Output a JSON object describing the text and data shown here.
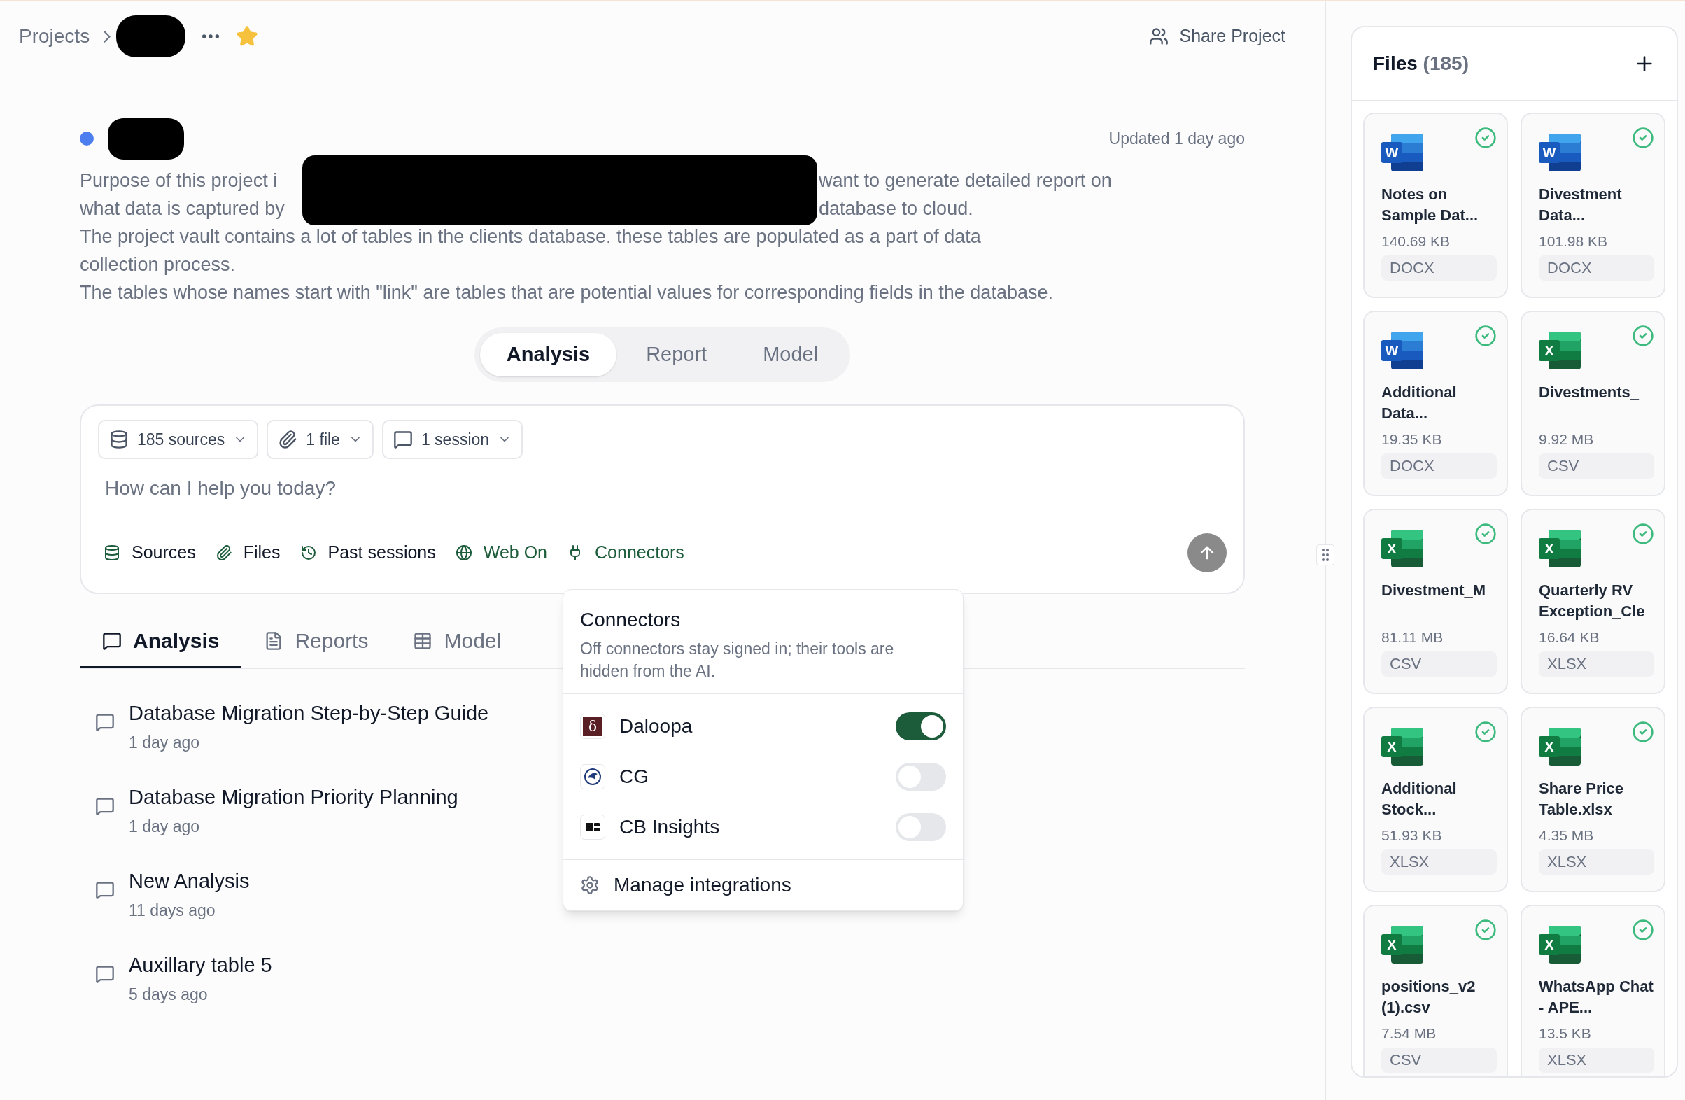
{
  "breadcrumb": {
    "root": "Projects",
    "starred": true
  },
  "share_button": "Share Project",
  "project": {
    "updated": "Updated 1 day ago",
    "description_lines": [
      {
        "segments": [
          "Purpose of this project i",
          "want to generate detailed report on"
        ]
      },
      {
        "segments": [
          "what data is captured by",
          "database to cloud."
        ]
      },
      {
        "segments": [
          "The project vault contains a lot of tables in the clients database. these tables are populated as a part of data"
        ]
      },
      {
        "segments": [
          "collection process."
        ]
      },
      {
        "segments": [
          "The tables whose names start with \"link\" are tables that are potential values for corresponding fields in the database."
        ]
      }
    ]
  },
  "view_tabs": [
    {
      "label": "Analysis",
      "selected": true
    },
    {
      "label": "Report",
      "selected": false
    },
    {
      "label": "Model",
      "selected": false
    }
  ],
  "composer": {
    "chips": [
      {
        "kind": "sources",
        "label": "185 sources"
      },
      {
        "kind": "files",
        "label": "1 file"
      },
      {
        "kind": "sessions",
        "label": "1 session"
      }
    ],
    "placeholder": "How can I help you today?",
    "tools": [
      {
        "kind": "sources",
        "label": "Sources",
        "active": false
      },
      {
        "kind": "files",
        "label": "Files",
        "active": false
      },
      {
        "kind": "sessions",
        "label": "Past sessions",
        "active": false
      },
      {
        "kind": "web",
        "label": "Web On",
        "active": true
      },
      {
        "kind": "connectors",
        "label": "Connectors",
        "active": true
      }
    ]
  },
  "section_tabs": [
    {
      "kind": "analysis",
      "label": "Analysis",
      "selected": true
    },
    {
      "kind": "reports",
      "label": "Reports",
      "selected": false
    },
    {
      "kind": "model",
      "label": "Model",
      "selected": false
    }
  ],
  "sessions": [
    {
      "title": "Database Migration Step-by-Step Guide",
      "time": "1 day ago"
    },
    {
      "title": "Database Migration Priority Planning",
      "time": "1 day ago"
    },
    {
      "title": "New Analysis",
      "time": "11 days ago"
    },
    {
      "title": "Auxillary table 5",
      "time": "5 days ago"
    }
  ],
  "connectors_popup": {
    "title": "Connectors",
    "description": "Off connectors stay signed in; their tools are hidden from the AI.",
    "items": [
      {
        "kind": "glyph",
        "glyph": "δ",
        "name": "Daloopa",
        "on": true
      },
      {
        "kind": "emblem",
        "name": "CG",
        "on": false
      },
      {
        "kind": "blocks",
        "name": "CB Insights",
        "on": false
      }
    ],
    "manage": "Manage integrations"
  },
  "files": {
    "title": "Files",
    "count": "(185)",
    "items": [
      {
        "kind": "word",
        "letter": "W",
        "name": "Notes on Sample Dat...",
        "size": "140.69 KB",
        "type": "DOCX",
        "ready": true
      },
      {
        "kind": "word",
        "letter": "W",
        "name": "Divestment Data...",
        "size": "101.98 KB",
        "type": "DOCX",
        "ready": true
      },
      {
        "kind": "word",
        "letter": "W",
        "name": "Additional Data...",
        "size": "19.35 KB",
        "type": "DOCX",
        "ready": true
      },
      {
        "kind": "excel",
        "letter": "X",
        "name": "Divestments_",
        "size": "9.92 MB",
        "type": "CSV",
        "ready": true
      },
      {
        "kind": "excel",
        "letter": "X",
        "name": "Divestment_M",
        "size": "81.11 MB",
        "type": "CSV",
        "ready": true
      },
      {
        "kind": "excel",
        "letter": "X",
        "name": "Quarterly RV Exception_Cle",
        "size": "16.64 KB",
        "type": "XLSX",
        "ready": true
      },
      {
        "kind": "excel",
        "letter": "X",
        "name": "Additional Stock...",
        "size": "51.93 KB",
        "type": "XLSX",
        "ready": true
      },
      {
        "kind": "excel",
        "letter": "X",
        "name": "Share Price Table.xlsx",
        "size": "4.35 MB",
        "type": "XLSX",
        "ready": true
      },
      {
        "kind": "excel",
        "letter": "X",
        "name": "positions_v2 (1).csv",
        "size": "7.54 MB",
        "type": "CSV",
        "ready": true
      },
      {
        "kind": "excel",
        "letter": "X",
        "name": "WhatsApp Chat - APE...",
        "size": "13.5 KB",
        "type": "XLSX",
        "ready": true
      }
    ]
  }
}
